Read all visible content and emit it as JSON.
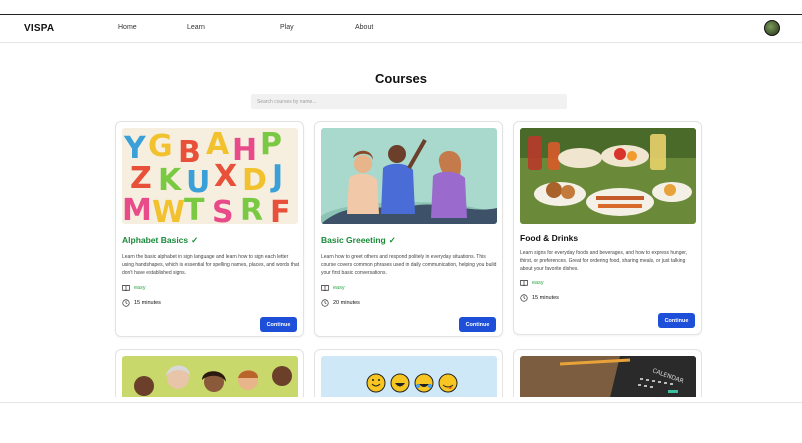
{
  "nav": {
    "brand": "VISPA",
    "links": [
      "Home",
      "Learn",
      "Play",
      "About"
    ]
  },
  "page": {
    "title": "Courses",
    "search_placeholder": "Search courses by name..."
  },
  "courses": [
    {
      "title": "Alphabet Basics",
      "completed": true,
      "check": "✓",
      "description": "Learn the basic alphabet in sign language and learn how to sign each letter using handshapes, which is essential for spelling names, places, and words that don't have established signs.",
      "difficulty": "easy",
      "duration": "15 minutes",
      "button": "Continue"
    },
    {
      "title": "Basic Greeeting",
      "completed": true,
      "check": "✓",
      "description": "Learn how to greet others and respond politely in everyday situations. This course covers common phrases used in daily communication, helping you build your first basic conversations.",
      "difficulty": "easy",
      "duration": "20 minutes",
      "button": "Continue"
    },
    {
      "title": "Food & Drinks",
      "completed": false,
      "check": "",
      "description": "Learn signs for everyday foods and beverages, and how to express hunger, thirst, or preferences. Great for ordering food, sharing meals, or just talking about your favorite dishes.",
      "difficulty": "easy",
      "duration": "15 minutes",
      "button": "Continue"
    }
  ],
  "colors": {
    "accent": "#1e4fd8",
    "completed": "#1a8a3a",
    "difficulty": "#28a745"
  }
}
